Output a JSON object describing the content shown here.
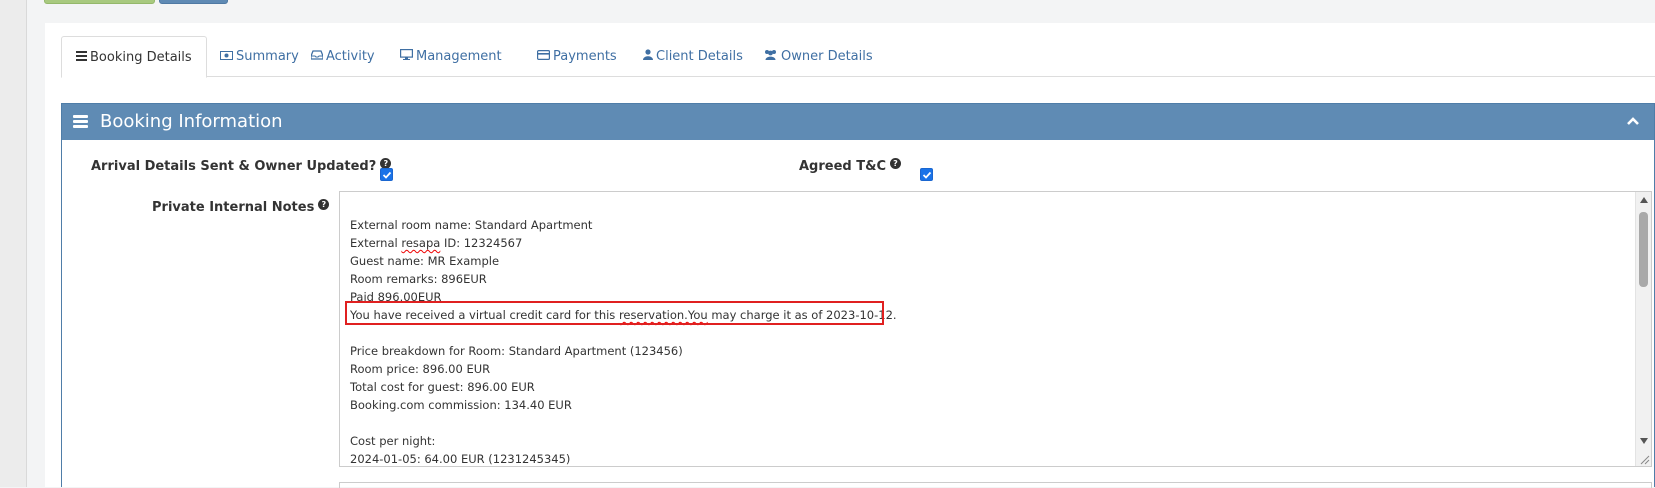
{
  "tabs": [
    {
      "label": "Booking Details",
      "icon": "list-icon",
      "active": true
    },
    {
      "label": "Summary",
      "icon": "money-icon"
    },
    {
      "label": "Activity",
      "icon": "inbox-icon"
    },
    {
      "label": "Management",
      "icon": "desktop-icon"
    },
    {
      "label": "Payments",
      "icon": "credit-card-icon"
    },
    {
      "label": "Client Details",
      "icon": "user-icon"
    },
    {
      "label": "Owner Details",
      "icon": "users-icon"
    }
  ],
  "panel": {
    "title": "Booking Information"
  },
  "fields": {
    "arrival_label": "Arrival Details Sent & Owner Updated?",
    "arrival_checked": true,
    "agreed_label": "Agreed T&C",
    "agreed_checked": true,
    "notes_label": "Private Internal Notes"
  },
  "notes": {
    "external_room": "External room name: Standard Apartment",
    "external_resapa_prefix": "External ",
    "external_resapa_word": "resapa",
    "external_resapa_suffix": " ID: 12324567",
    "guest_name": "Guest name: MR Example",
    "room_remarks": "Room remarks: 896EUR",
    "paid": "Paid 896.00EUR",
    "vcc_prefix": "You have received a virtual credit card for this ",
    "vcc_word": "reservation.You",
    "vcc_suffix": " may charge it as of 2023-10-12.",
    "price_breakdown": "Price breakdown for Room: Standard Apartment (123456)",
    "room_price": "Room price: 896.00 EUR",
    "total_cost": "Total cost for guest: 896.00 EUR",
    "commission": "Booking.com commission: 134.40 EUR",
    "cost_per_night": "Cost per night:",
    "night_1": "2024-01-05: 64.00 EUR (1231245345)"
  },
  "colors": {
    "panel_header": "#5f8bb4",
    "link": "#3f6fa3",
    "highlight_border": "#e02020",
    "checkbox": "#1a73e8"
  }
}
